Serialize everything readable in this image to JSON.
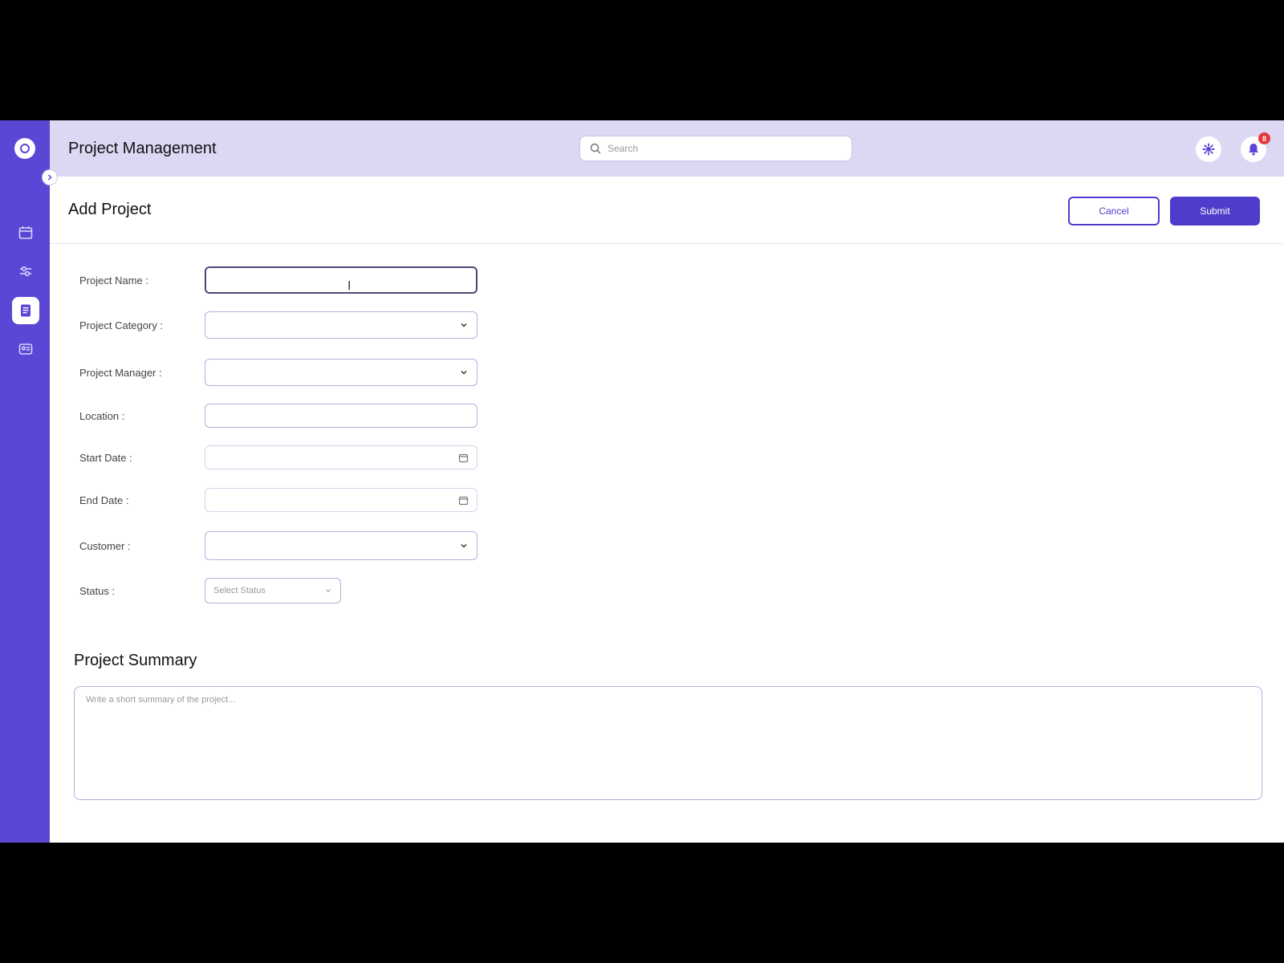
{
  "header": {
    "app_title": "Project Management",
    "search_placeholder": "Search",
    "notification_count": "8"
  },
  "subheader": {
    "title": "Add Project",
    "cancel_label": "Cancel",
    "submit_label": "Submit"
  },
  "form": {
    "project_name_label": "Project Name :",
    "project_category_label": "Project Category :",
    "project_manager_label": "Project Manager :",
    "location_label": "Location :",
    "start_date_label": "Start Date :",
    "end_date_label": "End Date :",
    "customer_label": "Customer :",
    "status_label": "Status :",
    "status_placeholder": "Select Status"
  },
  "summary": {
    "title": "Project Summary",
    "placeholder": "Write a short summary of the project..."
  },
  "colors": {
    "sidebar": "#5a47d6",
    "header": "#dcd8f3",
    "primary": "#4e3dcb",
    "badge": "#e5383b"
  }
}
